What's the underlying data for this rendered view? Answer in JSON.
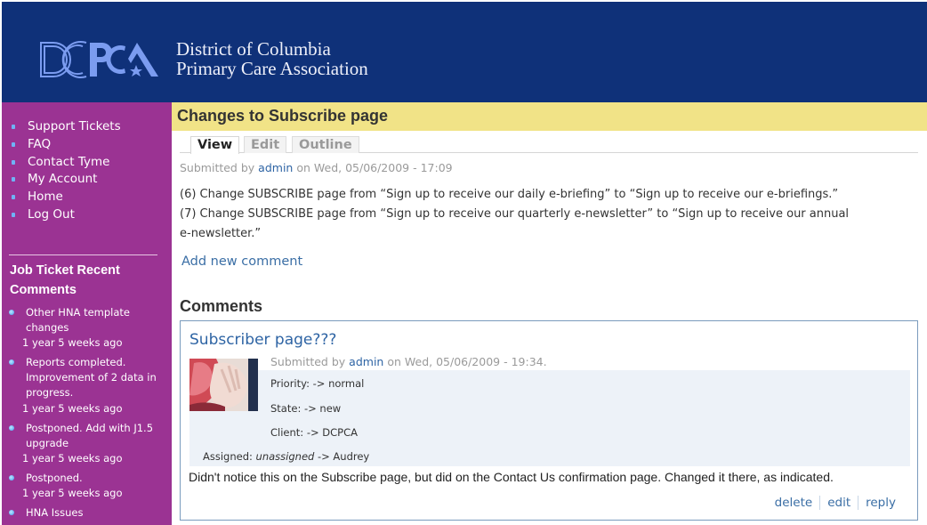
{
  "header": {
    "logo_text": "DCPCA",
    "site_name_line1": "District of Columbia",
    "site_name_line2": "Primary Care Association",
    "colors": {
      "header_bg": "#0f3179",
      "sidebar_bg": "#9b3393",
      "title_bar_bg": "#f1e387",
      "link": "#2e64a4"
    }
  },
  "sidebar": {
    "nav": [
      {
        "label": "Support Tickets",
        "icon": "arrow-bullet-icon"
      },
      {
        "label": "FAQ",
        "icon": "arrow-bullet-icon"
      },
      {
        "label": "Contact Tyme",
        "icon": "square-bullet-icon"
      },
      {
        "label": "My Account",
        "icon": "square-bullet-icon"
      },
      {
        "label": "Home",
        "icon": "square-bullet-icon"
      },
      {
        "label": "Log Out",
        "icon": "square-bullet-icon"
      }
    ],
    "recent_block": {
      "title": "Job Ticket Recent Comments",
      "items": [
        {
          "title": "Other HNA template changes",
          "ago": "1 year 5 weeks ago"
        },
        {
          "title": "Reports completed. Improvement of 2 data in progress.",
          "ago": "1 year 5 weeks ago"
        },
        {
          "title": "Postponed. Add with J1.5 upgrade",
          "ago": "1 year 5 weeks ago"
        },
        {
          "title": "Postponed.",
          "ago": "1 year 5 weeks ago"
        },
        {
          "title": "HNA Issues",
          "ago": ""
        }
      ]
    }
  },
  "page": {
    "title": "Changes to Subscribe page",
    "tabs": [
      {
        "label": "View",
        "active": true
      },
      {
        "label": "Edit",
        "active": false
      },
      {
        "label": "Outline",
        "active": false
      }
    ],
    "submitted_prefix": "Submitted by",
    "author": "admin",
    "submitted_on": "on Wed, 05/06/2009 - 17:09",
    "body_line1": "(6) Change SUBSCRIBE page from “Sign up to receive our daily e-briefing” to “Sign up to receive our e-briefings.”",
    "body_line2": "(7) Change SUBSCRIBE page from “Sign up to receive our quarterly e-newsletter” to “Sign up to receive our annual",
    "body_line3": "e-newsletter.”",
    "add_comment": "Add new comment"
  },
  "comments": {
    "heading": "Comments",
    "items": [
      {
        "title": "Subscriber page???",
        "submitted_prefix": "Submitted by",
        "author": "admin",
        "submitted_on": "on Wed, 05/06/2009 - 19:34.",
        "fields": {
          "priority": "Priority: -> normal",
          "state": "State: -> new",
          "client": "Client: -> DCPCA",
          "assigned_label": "Assigned:",
          "assigned_from": "unassigned",
          "assigned_to": "-> Audrey"
        },
        "body": "Didn't notice this on the Subscribe page, but did on the Contact Us confirmation page. Changed it there, as indicated.",
        "links": {
          "delete": "delete",
          "edit": "edit",
          "reply": "reply"
        }
      }
    ]
  }
}
